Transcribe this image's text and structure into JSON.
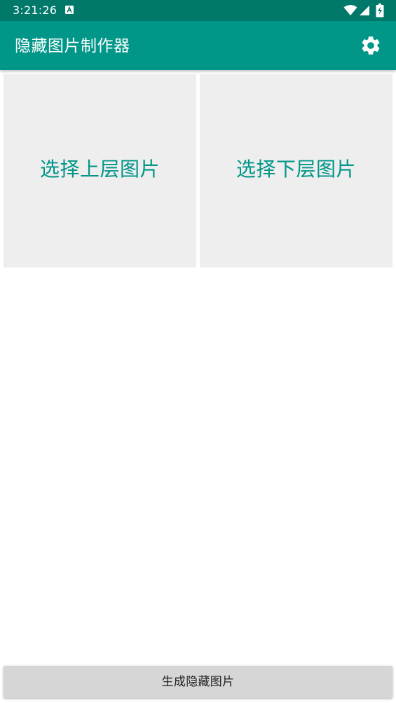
{
  "status_bar": {
    "time": "3:21:26",
    "notification_icon": "a-icon",
    "wifi_icon": "wifi-icon",
    "signal_icon": "cell-signal-icon",
    "battery_icon": "battery-charging-icon",
    "background_color": "#00796b"
  },
  "app_bar": {
    "title": "隐藏图片制作器",
    "settings_icon": "gear-icon",
    "background_color": "#009688"
  },
  "main": {
    "top_image_label": "选择上层图片",
    "bottom_image_label": "选择下层图片",
    "tile_background": "#eeeeee",
    "tile_text_color": "#009688"
  },
  "footer": {
    "generate_label": "生成隐藏图片",
    "button_background": "#d6d6d6"
  }
}
